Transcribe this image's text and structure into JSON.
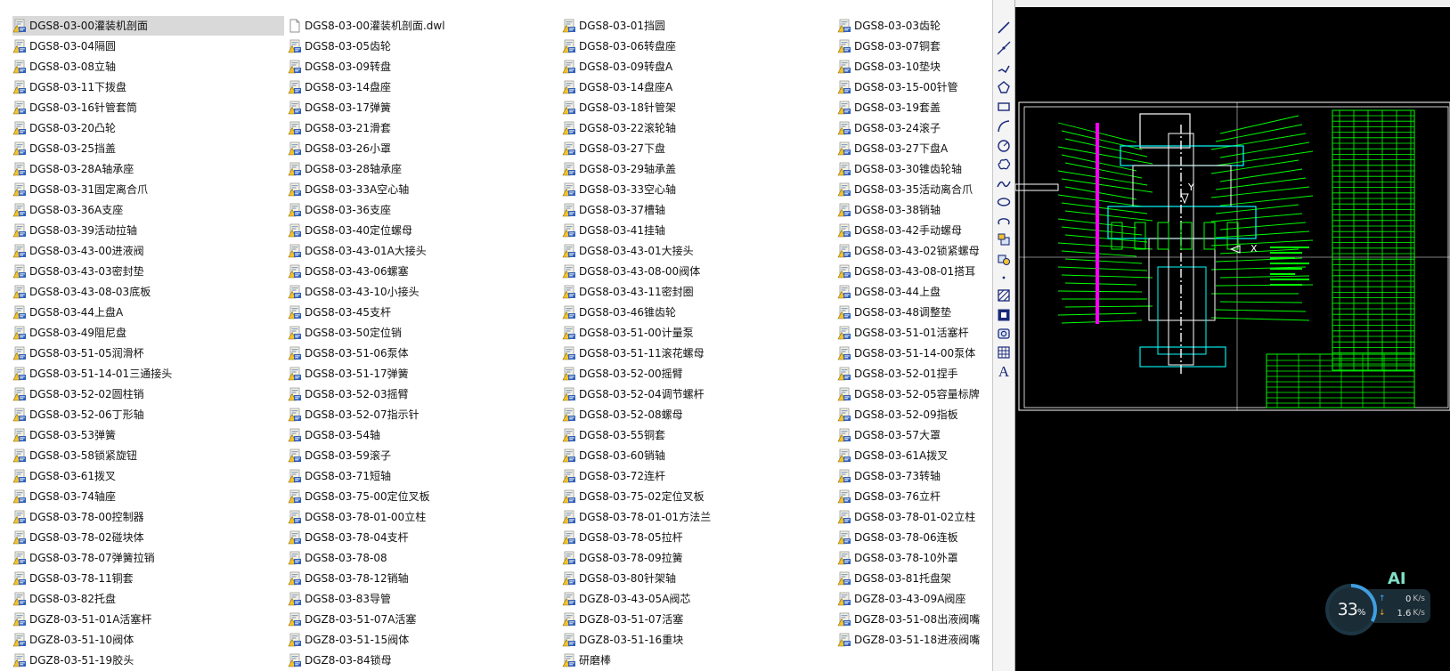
{
  "files": [
    [
      "DGS8-03-00灌装机剖面",
      "DGS8-03-04隔圆",
      "DGS8-03-08立轴",
      "DGS8-03-11下拨盘",
      "DGS8-03-16针管套筒",
      "DGS8-03-20凸轮",
      "DGS8-03-25挡盖",
      "DGS8-03-28A轴承座",
      "DGS8-03-31固定离合爪",
      "DGS8-03-36A支座",
      "DGS8-03-39活动拉轴",
      "DGS8-03-43-00进液阀",
      "DGS8-03-43-03密封垫",
      "DGS8-03-43-08-03底板",
      "DGS8-03-44上盘A",
      "DGS8-03-49阻尼盘",
      "DGS8-03-51-05润滑杯",
      "DGS8-03-51-14-01三通接头",
      "DGS8-03-52-02圆柱销",
      "DGS8-03-52-06丁形轴",
      "DGS8-03-53弹簧",
      "DGS8-03-58锁紧旋钮",
      "DGS8-03-61拨叉",
      "DGS8-03-74轴座",
      "DGS8-03-78-00控制器",
      "DGS8-03-78-02碰块体",
      "DGS8-03-78-07弹簧拉销",
      "DGS8-03-78-11铜套",
      "DGS8-03-82托盘",
      "DGZ8-03-51-01A活塞杆",
      "DGZ8-03-51-10阀体",
      "DGZ8-03-51-19胶头"
    ],
    [
      "DGS8-03-00灌装机剖面.dwl",
      "DGS8-03-05齿轮",
      "DGS8-03-09转盘",
      "DGS8-03-14盘座",
      "DGS8-03-17弹簧",
      "DGS8-03-21滑套",
      "DGS8-03-26小罩",
      "DGS8-03-28轴承座",
      "DGS8-03-33A空心轴",
      "DGS8-03-36支座",
      "DGS8-03-40定位螺母",
      "DGS8-03-43-01A大接头",
      "DGS8-03-43-06螺塞",
      "DGS8-03-43-10小接头",
      "DGS8-03-45支杆",
      "DGS8-03-50定位销",
      "DGS8-03-51-06泵体",
      "DGS8-03-51-17弹簧",
      "DGS8-03-52-03摇臂",
      "DGS8-03-52-07指示针",
      "DGS8-03-54轴",
      "DGS8-03-59滚子",
      "DGS8-03-71短轴",
      "DGS8-03-75-00定位叉板",
      "DGS8-03-78-01-00立柱",
      "DGS8-03-78-04支杆",
      "DGS8-03-78-08",
      "DGS8-03-78-12销轴",
      "DGS8-03-83导管",
      "DGZ8-03-51-07A活塞",
      "DGZ8-03-51-15阀体",
      "DGZ8-03-84锁母"
    ],
    [
      "DGS8-03-01挡圆",
      "DGS8-03-06转盘座",
      "DGS8-03-09转盘A",
      "DGS8-03-14盘座A",
      "DGS8-03-18针管架",
      "DGS8-03-22滚轮轴",
      "DGS8-03-27下盘",
      "DGS8-03-29轴承盖",
      "DGS8-03-33空心轴",
      "DGS8-03-37槽轴",
      "DGS8-03-41挂轴",
      "DGS8-03-43-01大接头",
      "DGS8-03-43-08-00阀体",
      "DGS8-03-43-11密封圈",
      "DGS8-03-46锥齿轮",
      "DGS8-03-51-00计量泵",
      "DGS8-03-51-11滚花螺母",
      "DGS8-03-52-00摇臂",
      "DGS8-03-52-04调节螺杆",
      "DGS8-03-52-08螺母",
      "DGS8-03-55铜套",
      "DGS8-03-60销轴",
      "DGS8-03-72连杆",
      "DGS8-03-75-02定位叉板",
      "DGS8-03-78-01-01方法兰",
      "DGS8-03-78-05拉杆",
      "DGS8-03-78-09拉簧",
      "DGS8-03-80针架轴",
      "DGZ8-03-43-05A阀芯",
      "DGZ8-03-51-07活塞",
      "DGZ8-03-51-16重块",
      "研磨棒"
    ],
    [
      "DGS8-03-03齿轮",
      "DGS8-03-07铜套",
      "DGS8-03-10垫块",
      "DGS8-03-15-00针管",
      "DGS8-03-19套盖",
      "DGS8-03-24滚子",
      "DGS8-03-27下盘A",
      "DGS8-03-30锥齿轮轴",
      "DGS8-03-35活动离合爪",
      "DGS8-03-38销轴",
      "DGS8-03-42手动螺母",
      "DGS8-03-43-02锁紧螺母",
      "DGS8-03-43-08-01搭耳",
      "DGS8-03-44上盘",
      "DGS8-03-48调整垫",
      "DGS8-03-51-01活塞杆",
      "DGS8-03-51-14-00泵体",
      "DGS8-03-52-01捏手",
      "DGS8-03-52-05容量标牌",
      "DGS8-03-52-09指板",
      "DGS8-03-57大罩",
      "DGS8-03-61A拨叉",
      "DGS8-03-73转轴",
      "DGS8-03-76立杆",
      "DGS8-03-78-01-02立柱",
      "DGS8-03-78-06连板",
      "DGS8-03-78-10外罩",
      "DGS8-03-81托盘架",
      "DGZ8-03-43-09A阀座",
      "DGZ8-03-51-08出液阀嘴",
      "DGZ8-03-51-18进液阀嘴"
    ]
  ],
  "selected_file": "DGS8-03-00灌装机剖面",
  "file_icons": {
    "dwg": "autocad-drawing-icon",
    "dwl": "generic-file-icon"
  },
  "cad_toolbar": [
    {
      "name": "line-tool-icon"
    },
    {
      "name": "construction-line-tool-icon"
    },
    {
      "name": "polyline-tool-icon"
    },
    {
      "name": "polygon-tool-icon"
    },
    {
      "name": "rectangle-tool-icon"
    },
    {
      "name": "arc-tool-icon"
    },
    {
      "name": "circle-tool-icon"
    },
    {
      "name": "revision-cloud-tool-icon"
    },
    {
      "name": "spline-tool-icon"
    },
    {
      "name": "ellipse-tool-icon"
    },
    {
      "name": "ellipse-arc-tool-icon"
    },
    {
      "name": "insert-block-tool-icon"
    },
    {
      "name": "make-block-tool-icon"
    },
    {
      "name": "point-tool-icon"
    },
    {
      "name": "hatch-tool-icon"
    },
    {
      "name": "gradient-tool-icon"
    },
    {
      "name": "region-tool-icon"
    },
    {
      "name": "table-tool-icon"
    },
    {
      "name": "multiline-text-tool-icon",
      "label": "A"
    }
  ],
  "cad_colors": {
    "background": "#000000",
    "dimension_lines": "#00ff00",
    "geometry": "#ffffff",
    "centerlines": "#00ffff",
    "accent": "#ff00ff"
  },
  "network_monitor": {
    "brand": "AI",
    "cpu_percent": 33,
    "cpu_unit": "%",
    "upload_value": "0",
    "download_value": "1.6",
    "speed_unit": "K/s"
  }
}
